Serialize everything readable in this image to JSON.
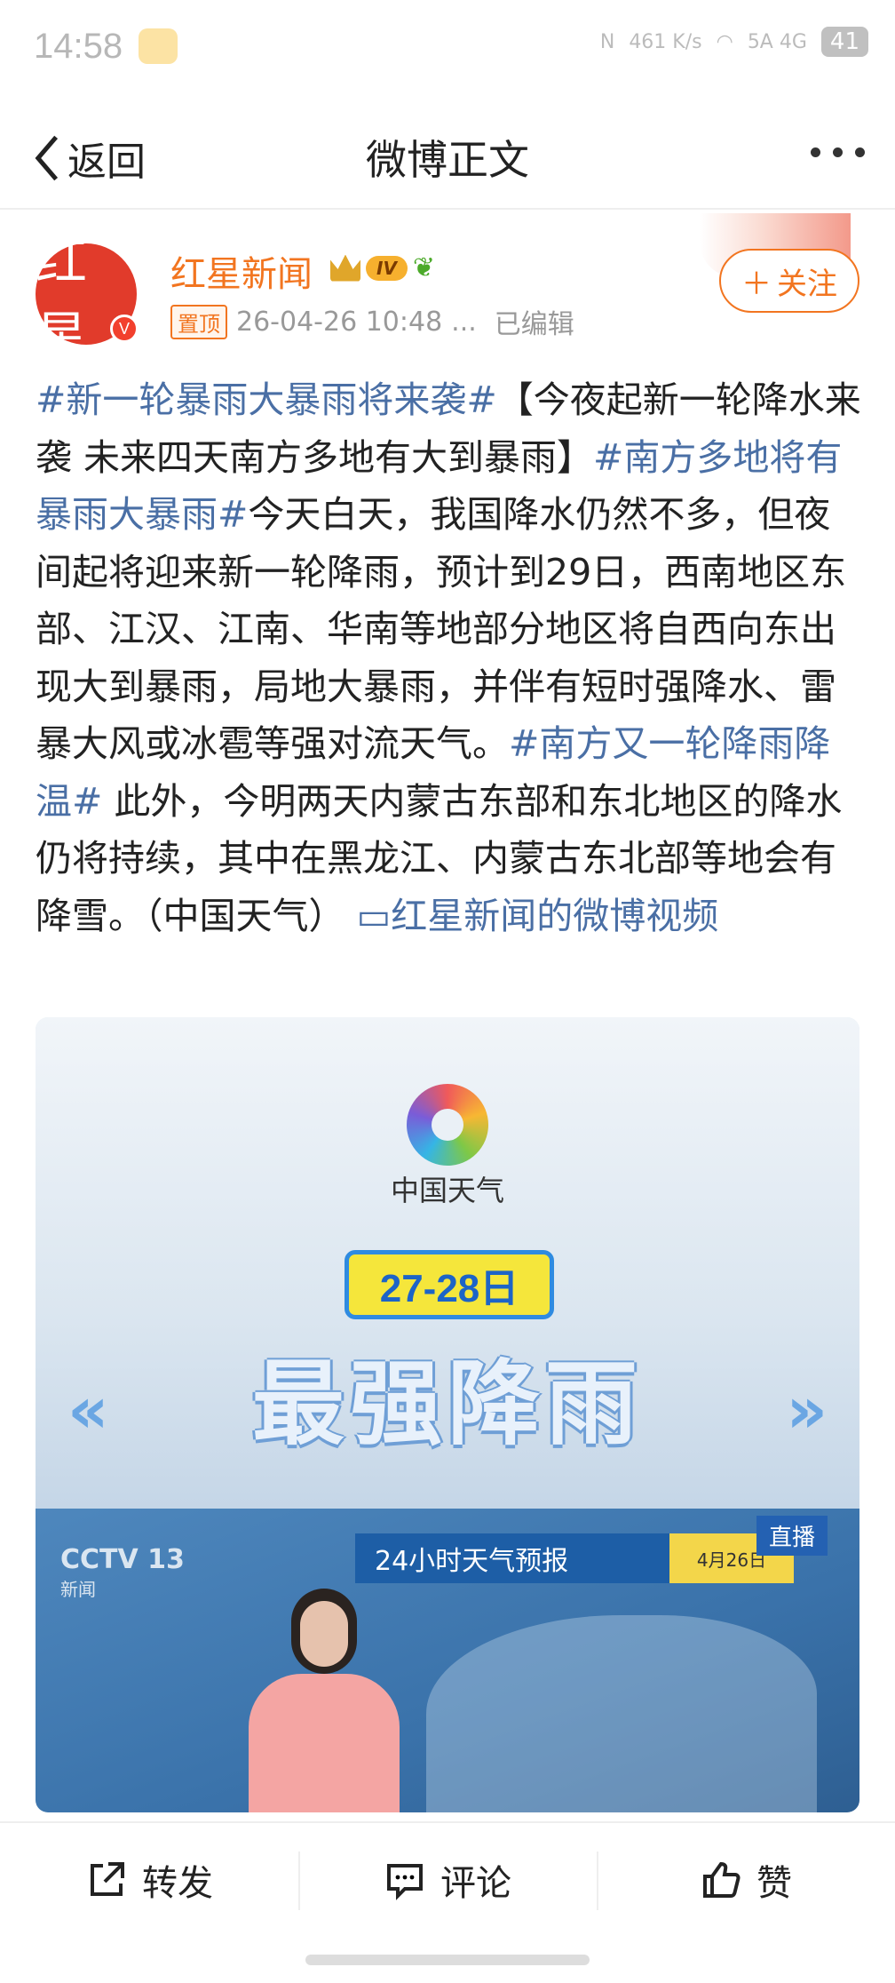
{
  "status_bar": {
    "time": "14:58",
    "speed": "461 K/s",
    "network": "5A 4G",
    "battery": "41"
  },
  "nav": {
    "back_label": "返回",
    "title": "微博正文"
  },
  "author": {
    "avatar_text": "红星",
    "name": "红星新闻",
    "level": "IV",
    "pinned_label": "置顶",
    "timestamp": "26-04-26 10:48",
    "ellipsis": "...",
    "edited_label": "已编辑",
    "follow_label": "关注"
  },
  "post": {
    "tag1": "#新一轮暴雨大暴雨将来袭#",
    "text1": "【今夜起新一轮降水来袭 未来四天南方多地有大到暴雨】",
    "tag2": "#南方多地将有暴雨大暴雨#",
    "text2": "今天白天，我国降水仍然不多，但夜间起将迎来新一轮降雨，预计到29日，西南地区东部、江汉、江南、华南等地部分地区将自西向东出现大到暴雨，局地大暴雨，并伴有短时强降水、雷暴大风或冰雹等强对流天气。",
    "tag3": "#南方又一轮降雨降温#",
    "text3": " 此外，今明两天内蒙古东部和东北地区的降水仍将持续，其中在黑龙江、内蒙古东北部等地会有降雪。（中国天气）",
    "video_link": "红星新闻的微博视频"
  },
  "media": {
    "logo_text": "中国天气",
    "date_badge": "27-28日",
    "headline": "最强降雨",
    "channel": "CCTV 13",
    "channel_sub": "新闻",
    "forecast_bar": "24小时天气预报",
    "bar_date": "4月26日",
    "live_label": "直播"
  },
  "actions": {
    "repost": "转发",
    "comment": "评论",
    "like": "赞"
  }
}
